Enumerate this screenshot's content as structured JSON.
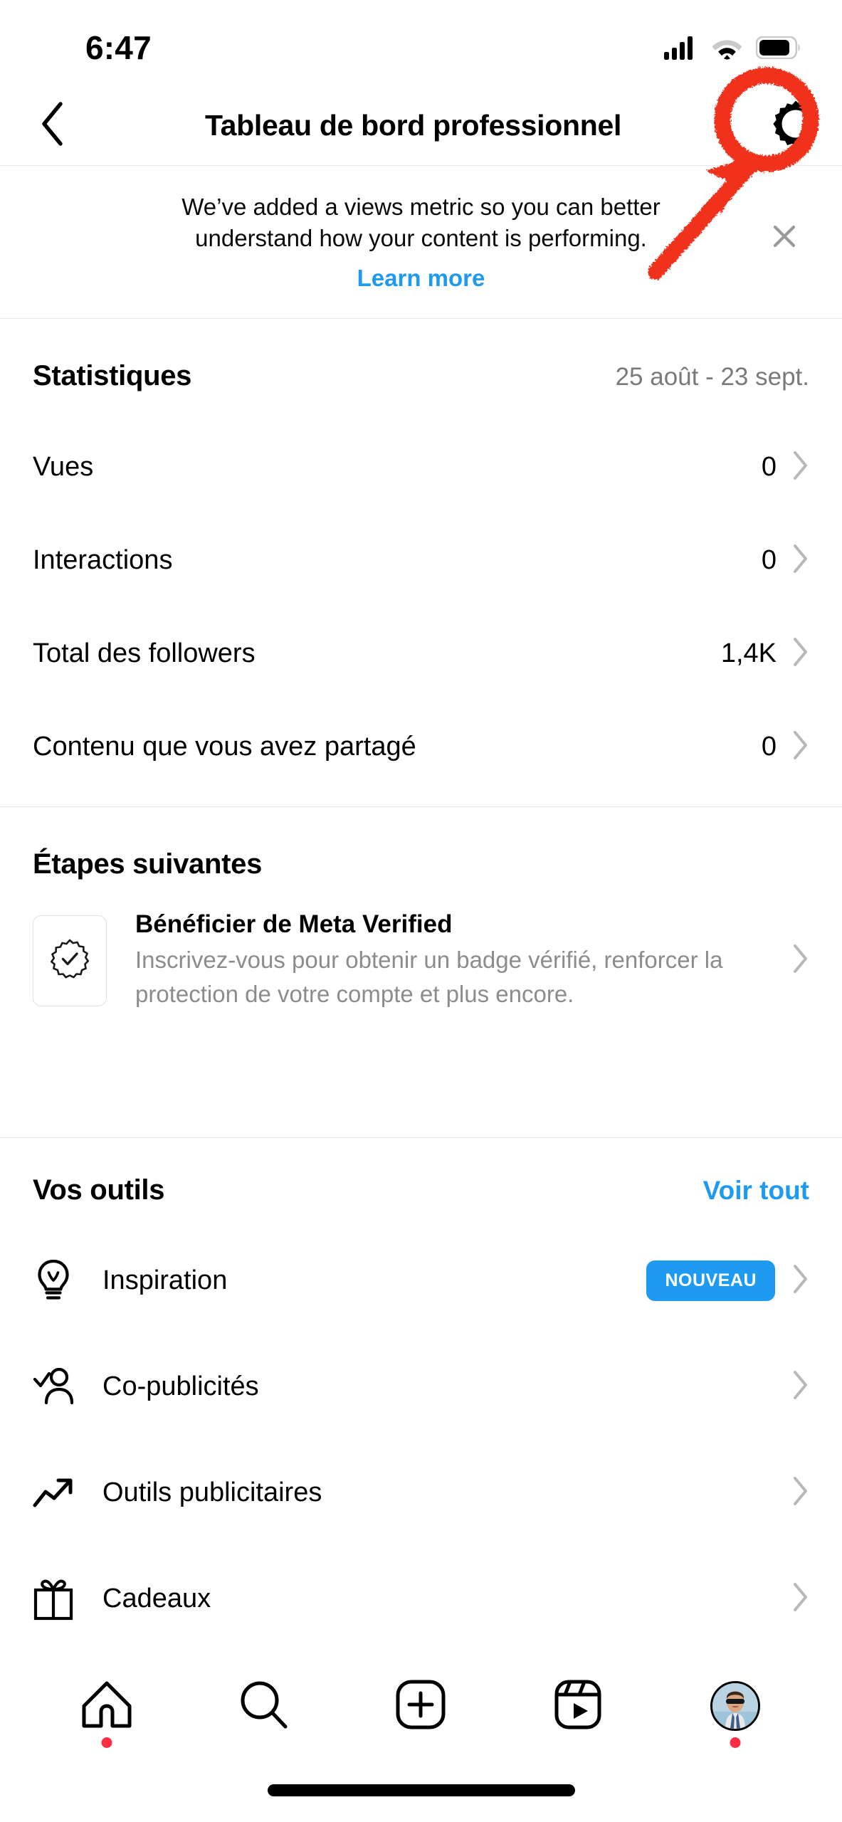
{
  "status_bar": {
    "time": "6:47",
    "icons": [
      "cellular-signal-icon",
      "wifi-icon",
      "battery-icon"
    ]
  },
  "header": {
    "back_icon": "chevron-left-icon",
    "title": "Tableau de bord professionnel",
    "settings_icon": "gear-icon"
  },
  "banner": {
    "message": "We’ve added a views metric so you can better understand how your content is performing.",
    "link_label": "Learn more",
    "close_icon": "close-icon"
  },
  "annotation": {
    "type": "highlight-circle-with-arrow",
    "color": "#F0301A",
    "target": "gear-icon"
  },
  "stats": {
    "title": "Statistiques",
    "date_range": "25 août - 23 sept.",
    "rows": [
      {
        "label": "Vues",
        "value": "0"
      },
      {
        "label": "Interactions",
        "value": "0"
      },
      {
        "label": "Total des followers",
        "value": "1,4K"
      },
      {
        "label": "Contenu que vous avez partagé",
        "value": "0"
      }
    ]
  },
  "next_steps": {
    "title": "Étapes suivantes",
    "items": [
      {
        "icon": "verified-badge-icon",
        "title": "Bénéficier de Meta Verified",
        "description": "Inscrivez-vous pour obtenir un badge vérifié, renforcer la protection de votre compte et plus encore."
      }
    ]
  },
  "tools": {
    "title": "Vos outils",
    "action_label": "Voir tout",
    "items": [
      {
        "icon": "lightbulb-icon",
        "label": "Inspiration",
        "badge": "NOUVEAU"
      },
      {
        "icon": "person-check-icon",
        "label": "Co-publicités",
        "badge": ""
      },
      {
        "icon": "trending-up-icon",
        "label": "Outils publicitaires",
        "badge": ""
      },
      {
        "icon": "gift-icon",
        "label": "Cadeaux",
        "badge": ""
      }
    ]
  },
  "tabbar": {
    "items": [
      {
        "icon": "home-icon",
        "dot": true
      },
      {
        "icon": "search-icon",
        "dot": false
      },
      {
        "icon": "create-plus-icon",
        "dot": false
      },
      {
        "icon": "reels-icon",
        "dot": false
      },
      {
        "icon": "profile-avatar",
        "dot": true
      }
    ]
  },
  "colors": {
    "accent_blue": "#1E9BF0",
    "annotation_red": "#F0301A",
    "notification_red": "#FF2D41",
    "muted_gray": "#8C8C8C",
    "divider": "#E9E9E9"
  }
}
